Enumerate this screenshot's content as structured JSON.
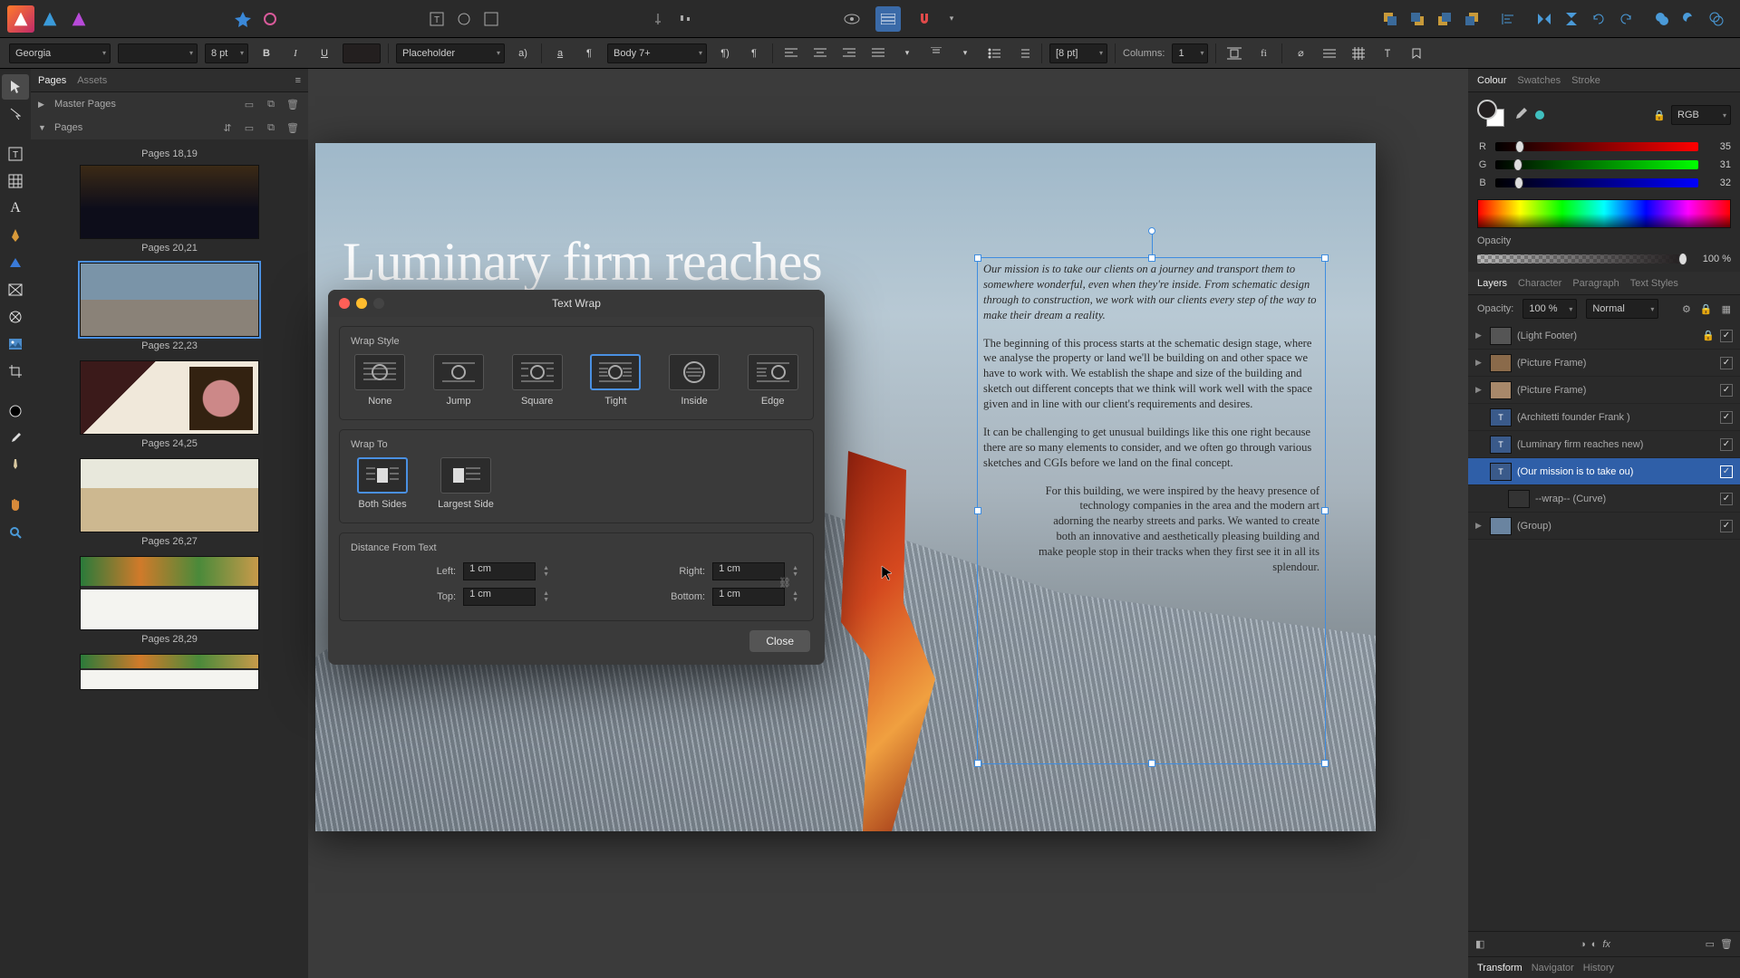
{
  "context": {
    "font": "Georgia",
    "font_size": "8 pt",
    "optical_align": "Placeholder",
    "paragraph_style": "Body 7+",
    "leading": "[8 pt]",
    "columns_label": "Columns:",
    "columns_value": "1"
  },
  "pages_panel": {
    "tabs": {
      "pages": "Pages",
      "assets": "Assets"
    },
    "sections": {
      "master": "Master Pages",
      "pages": "Pages"
    },
    "truncated_top": "Pages 18,19",
    "thumbs": [
      {
        "label": "Pages 20,21"
      },
      {
        "label": "Pages 22,23"
      },
      {
        "label": "Pages 24,25"
      },
      {
        "label": "Pages 26,27"
      },
      {
        "label": "Pages 28,29"
      }
    ]
  },
  "document": {
    "headline": "Luminary firm reaches new levels of design",
    "paragraphs": [
      "Our mission is to take our clients on a journey and transport them to somewhere wonderful, even when they're inside. From schematic design through to construction, we work with our clients every step of the way to make their dream a reality.",
      "The beginning of this process starts at the schematic design stage, where we analyse the property or land we'll be building on and other space we have to work with. We establish the shape and size of the building and sketch out different concepts that we think will work well with the space given and in line with our client's requirements and desires.",
      "It can be challenging to get unusual buildings like this one right because there are so many elements to consider, and we often go through various sketches and CGIs before we land on the final concept.",
      "For this building, we were inspired by the heavy presence of technology companies in the area and the modern art adorning the nearby streets and parks. We wanted to create both an innovative and aesthetically pleasing building and make people stop in their tracks when they first see it in all its splendour."
    ]
  },
  "dialog": {
    "title": "Text Wrap",
    "wrap_style_label": "Wrap Style",
    "styles": {
      "none": "None",
      "jump": "Jump",
      "square": "Square",
      "tight": "Tight",
      "inside": "Inside",
      "edge": "Edge"
    },
    "wrap_to_label": "Wrap To",
    "wrap_to": {
      "both": "Both Sides",
      "largest": "Largest Side"
    },
    "distance_label": "Distance From Text",
    "left_l": "Left:",
    "right_l": "Right:",
    "top_l": "Top:",
    "bottom_l": "Bottom:",
    "left": "1 cm",
    "right": "1 cm",
    "top": "1 cm",
    "bottom": "1 cm",
    "close": "Close"
  },
  "colour_panel": {
    "tabs": {
      "colour": "Colour",
      "swatches": "Swatches",
      "stroke": "Stroke"
    },
    "model": "RGB",
    "r_label": "R",
    "g_label": "G",
    "b_label": "B",
    "r": "35",
    "g": "31",
    "b": "32",
    "opacity_label": "Opacity",
    "opacity": "100 %"
  },
  "layers_panel": {
    "tabs": {
      "layers": "Layers",
      "character": "Character",
      "paragraph": "Paragraph",
      "styles": "Text Styles"
    },
    "opacity_label": "Opacity:",
    "opacity": "100 %",
    "blend": "Normal",
    "items": [
      {
        "name": "(Light Footer)"
      },
      {
        "name": "(Picture Frame)"
      },
      {
        "name": "(Picture Frame)"
      },
      {
        "name": "(Architetti founder Frank )"
      },
      {
        "name": "(Luminary firm reaches new)"
      },
      {
        "name": "(Our mission is to take ou)"
      },
      {
        "name": "--wrap-- (Curve)"
      },
      {
        "name": "(Group)"
      }
    ]
  },
  "bottom_tabs": {
    "transform": "Transform",
    "navigator": "Navigator",
    "history": "History"
  }
}
